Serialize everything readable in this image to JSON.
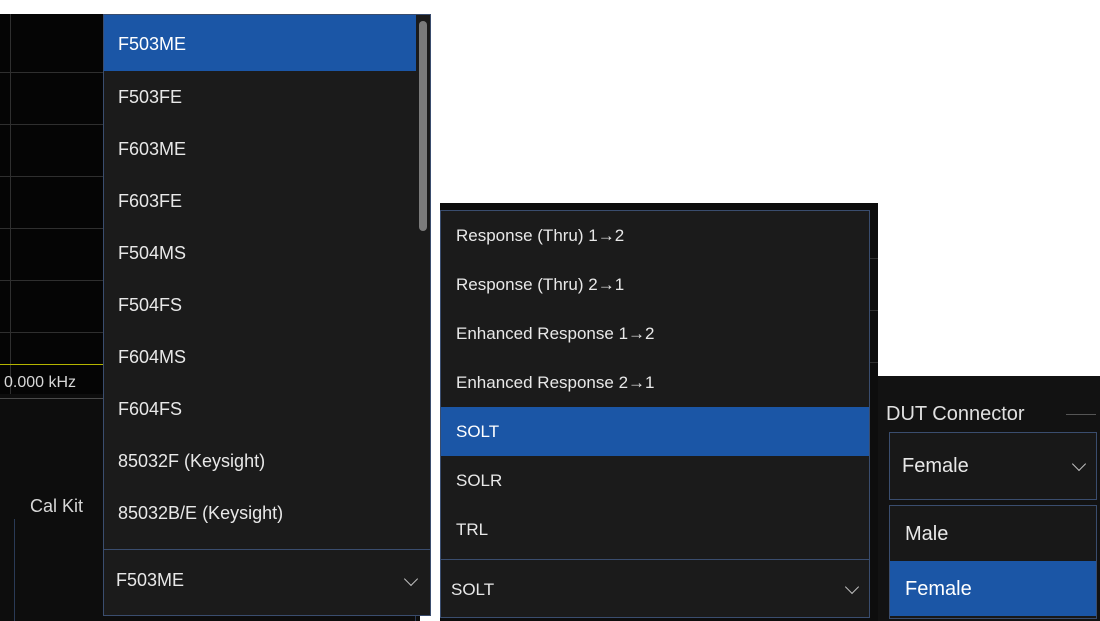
{
  "background": {
    "frequency_label": "0.000 kHz",
    "cal_kit_label": "Cal Kit"
  },
  "cal_kit_dropdown": {
    "items": [
      {
        "label": "F503ME",
        "selected": true
      },
      {
        "label": "F503FE",
        "selected": false
      },
      {
        "label": "F603ME",
        "selected": false
      },
      {
        "label": "F603FE",
        "selected": false
      },
      {
        "label": "F504MS",
        "selected": false
      },
      {
        "label": "F504FS",
        "selected": false
      },
      {
        "label": "F604MS",
        "selected": false
      },
      {
        "label": "F604FS",
        "selected": false
      },
      {
        "label": "85032F (Keysight)",
        "selected": false
      },
      {
        "label": "85032B/E (Keysight)",
        "selected": false
      }
    ],
    "current_value": "F503ME"
  },
  "cal_type_dropdown": {
    "items": [
      {
        "label": "Response (Thru) 1→2",
        "selected": false
      },
      {
        "label": "Response (Thru) 2→1",
        "selected": false
      },
      {
        "label": "Enhanced Response 1→2",
        "selected": false
      },
      {
        "label": "Enhanced Response 2→1",
        "selected": false
      },
      {
        "label": "SOLT",
        "selected": true
      },
      {
        "label": "SOLR",
        "selected": false
      },
      {
        "label": "TRL",
        "selected": false
      }
    ],
    "current_value": "SOLT"
  },
  "dut_connector": {
    "title": "DUT Connector",
    "current_value": "Female",
    "options": [
      {
        "label": "Male",
        "selected": false
      },
      {
        "label": "Female",
        "selected": true
      }
    ]
  },
  "colors": {
    "selection": "#1b56a6",
    "panel": "#1b1b1b",
    "border": "#3a4d6e",
    "text": "#e8e8e8"
  }
}
